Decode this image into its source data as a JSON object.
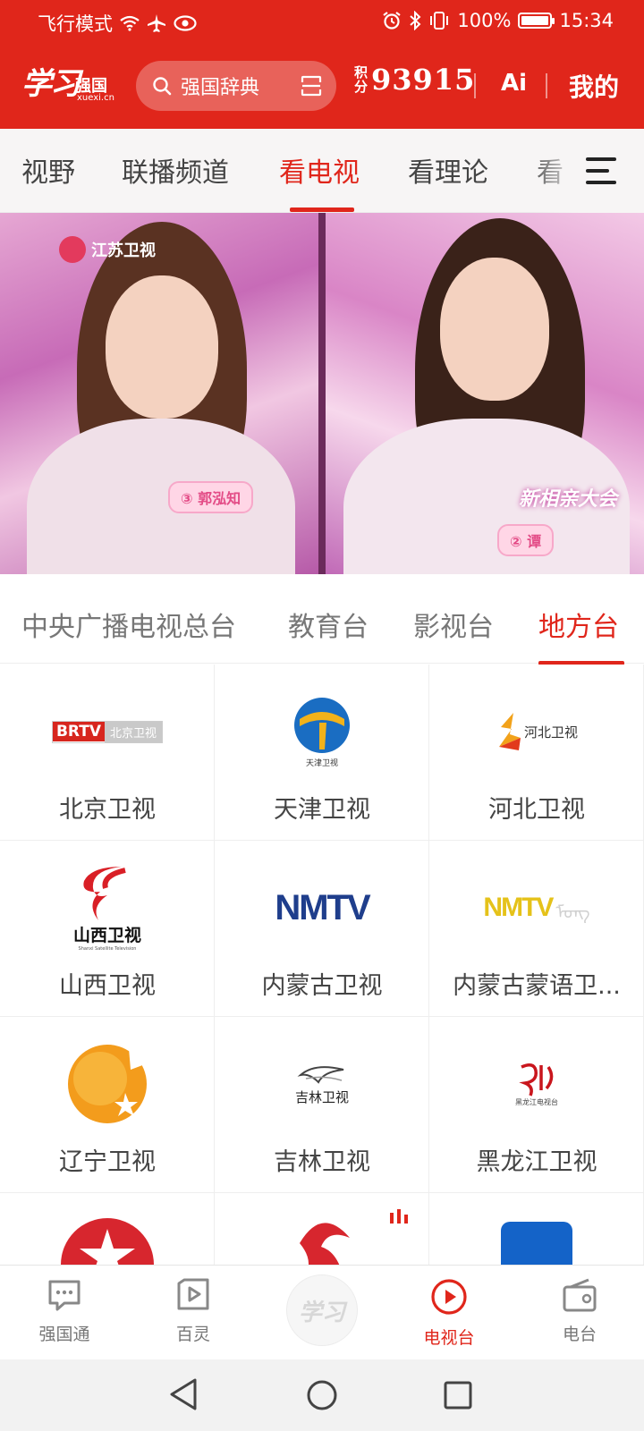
{
  "status_bar": {
    "mode": "飞行模式",
    "battery": "100%",
    "time": "15:34",
    "icons": [
      "wifi-icon",
      "airplane-icon",
      "eye-icon",
      "alarm-icon",
      "bluetooth-icon",
      "vibrate-icon",
      "battery-icon"
    ]
  },
  "header": {
    "logo_script": "学习",
    "logo_brand": "强国",
    "logo_domain": "xuexi.cn",
    "search_label": "强国辞典",
    "points_label_top": "积",
    "points_label_bottom": "分",
    "points_value": "93915",
    "ai_label": "Ai",
    "mine_label": "我的",
    "accent_color": "#e0261b"
  },
  "top_tabs": {
    "items": [
      "视野",
      "联播频道",
      "看电视",
      "看理论",
      "看"
    ],
    "active": "看电视"
  },
  "video": {
    "channel_logo": "江苏卫视",
    "tag_left": "③ 郭泓知",
    "tag_right": "② 谭",
    "show_mark": "新相亲大会"
  },
  "category_tabs": {
    "items": [
      "中央广播电视总台",
      "教育台",
      "影视台",
      "地方台"
    ],
    "active": "地方台"
  },
  "channels": [
    {
      "name": "北京卫视",
      "logo": "BRTV",
      "logo_sub": "北京卫视"
    },
    {
      "name": "天津卫视",
      "logo": "天津卫视"
    },
    {
      "name": "河北卫视",
      "logo": "河北卫视"
    },
    {
      "name": "山西卫视",
      "logo": "山西卫视",
      "logo_sub": "Shanxi Satellite Television"
    },
    {
      "name": "内蒙古卫视",
      "logo": "NMTV"
    },
    {
      "name": "内蒙古蒙语卫...",
      "logo": "NMTV"
    },
    {
      "name": "辽宁卫视",
      "logo": ""
    },
    {
      "name": "吉林卫视",
      "logo": "吉林卫视"
    },
    {
      "name": "黑龙江卫视",
      "logo": "黑龙江电视台"
    },
    {
      "name": "",
      "logo": ""
    },
    {
      "name": "",
      "logo": ""
    },
    {
      "name": "",
      "logo": ""
    }
  ],
  "bottom_nav": {
    "items": [
      {
        "label": "强国通",
        "icon": "chat-icon"
      },
      {
        "label": "百灵",
        "icon": "play-square-icon"
      },
      {
        "label": "学习",
        "icon": "xuexi-logo-icon"
      },
      {
        "label": "电视台",
        "icon": "tv-play-icon"
      },
      {
        "label": "电台",
        "icon": "radio-icon"
      }
    ],
    "active": "电视台"
  }
}
